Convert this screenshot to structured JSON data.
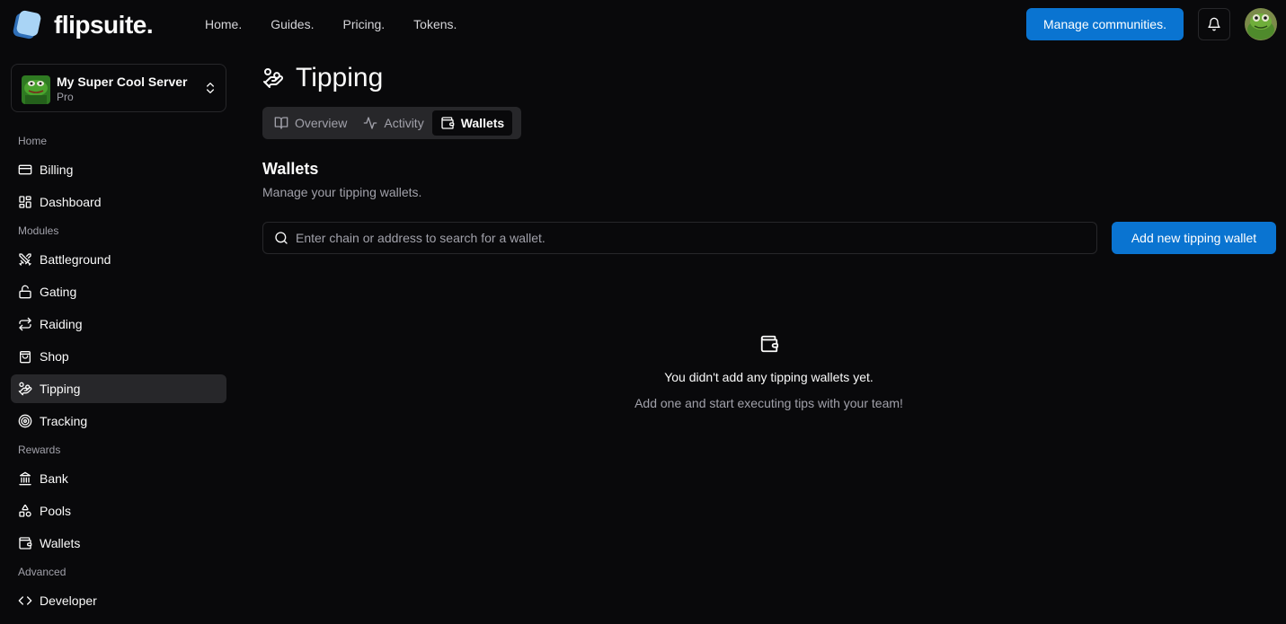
{
  "brand": {
    "name": "flipsuite."
  },
  "topnav": {
    "items": [
      "Home.",
      "Guides.",
      "Pricing.",
      "Tokens."
    ]
  },
  "header": {
    "manage_label": "Manage communities."
  },
  "server": {
    "name": "My Super Cool Server",
    "plan": "Pro"
  },
  "sidebar": {
    "sections": {
      "home": "Home",
      "modules": "Modules",
      "rewards": "Rewards",
      "advanced": "Advanced"
    },
    "items": [
      {
        "label": "Billing",
        "icon": "credit-card-icon"
      },
      {
        "label": "Dashboard",
        "icon": "dashboard-icon"
      },
      {
        "label": "Battleground",
        "icon": "swords-icon"
      },
      {
        "label": "Gating",
        "icon": "lock-icon"
      },
      {
        "label": "Raiding",
        "icon": "repeat-icon"
      },
      {
        "label": "Shop",
        "icon": "shopping-bag-icon"
      },
      {
        "label": "Tipping",
        "icon": "hand-coins-icon",
        "active": true
      },
      {
        "label": "Tracking",
        "icon": "target-icon"
      },
      {
        "label": "Bank",
        "icon": "bank-icon"
      },
      {
        "label": "Pools",
        "icon": "pools-icon"
      },
      {
        "label": "Wallets",
        "icon": "wallet-icon"
      },
      {
        "label": "Developer",
        "icon": "code-icon"
      }
    ]
  },
  "page": {
    "title": "Tipping"
  },
  "tabs": [
    {
      "label": "Overview",
      "active": false
    },
    {
      "label": "Activity",
      "active": false
    },
    {
      "label": "Wallets",
      "active": true
    }
  ],
  "wallets": {
    "title": "Wallets",
    "subtitle": "Manage your tipping wallets.",
    "search_placeholder": "Enter chain or address to search for a wallet.",
    "add_label": "Add new tipping wallet",
    "empty_title": "You didn't add any tipping wallets yet.",
    "empty_subtitle": "Add one and start executing tips with your team!"
  },
  "colors": {
    "accent": "#0a74d1",
    "background": "#09090b",
    "border": "#27272a",
    "muted": "#a1a1aa"
  }
}
